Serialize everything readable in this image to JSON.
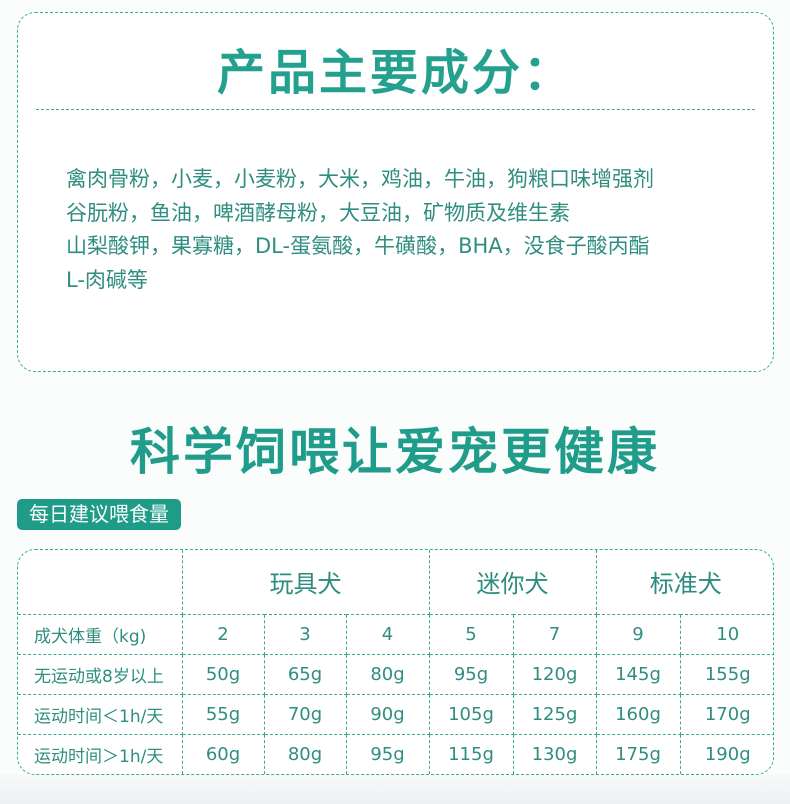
{
  "ingredients": {
    "title": "产品主要成分：",
    "lines": [
      "禽肉骨粉，小麦，小麦粉，大米，鸡油，牛油，狗粮口味增强剂",
      "谷朊粉，鱼油，啤酒酵母粉，大豆油，矿物质及维生素",
      "山梨酸钾，果寡糖，DL-蛋氨酸，牛磺酸，BHA，没食子酸丙酯",
      "L-肉碱等"
    ]
  },
  "slogan": "科学饲喂让爱宠更健康",
  "badge": "每日建议喂食量",
  "table": {
    "groups": [
      "玩具犬",
      "迷你犬",
      "标准犬"
    ],
    "rows": [
      {
        "label": "成犬体重（kg)",
        "cells": [
          "2",
          "3",
          "4",
          "5",
          "7",
          "9",
          "10"
        ]
      },
      {
        "label": "无运动或8岁以上",
        "cells": [
          "50g",
          "65g",
          "80g",
          "95g",
          "120g",
          "145g",
          "155g"
        ]
      },
      {
        "label": "运动时间＜1h/天",
        "cells": [
          "55g",
          "70g",
          "90g",
          "105g",
          "125g",
          "160g",
          "170g"
        ]
      },
      {
        "label": "运动时间＞1h/天",
        "cells": [
          "60g",
          "80g",
          "95g",
          "115g",
          "130g",
          "175g",
          "190g"
        ]
      }
    ]
  }
}
